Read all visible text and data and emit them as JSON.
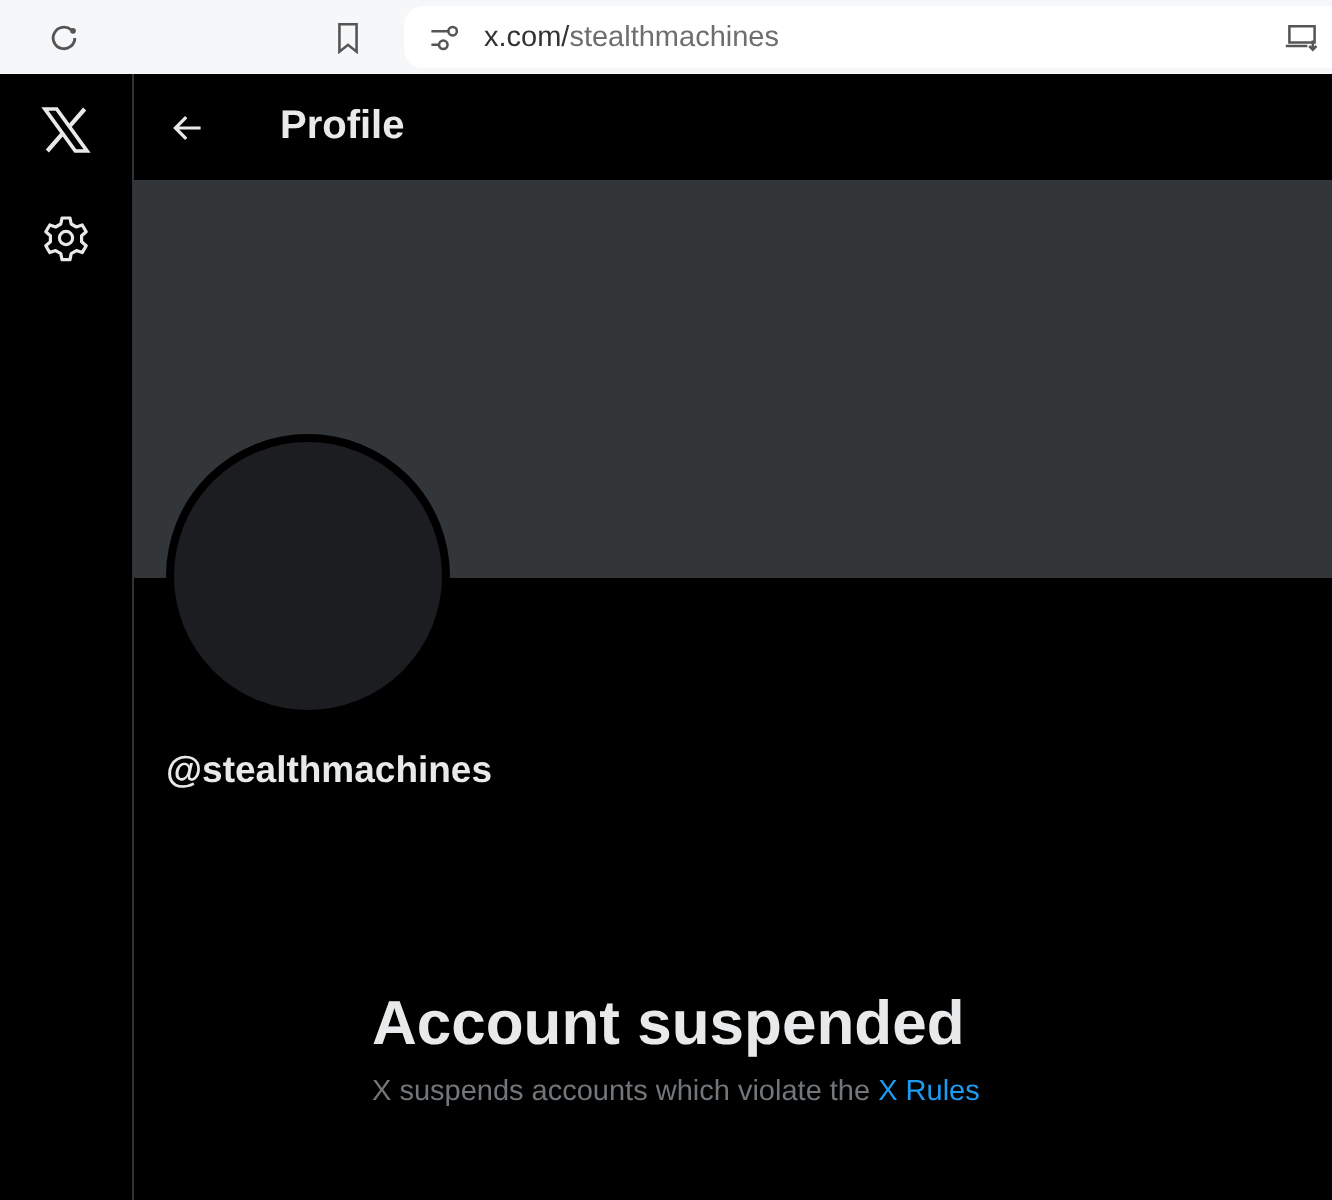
{
  "browser": {
    "url_host": "x.com/",
    "url_path": "stealthmachines"
  },
  "header": {
    "title": "Profile"
  },
  "profile": {
    "handle": "@stealthmachines"
  },
  "notice": {
    "title": "Account suspended",
    "message": "X suspends accounts which violate the ",
    "link": "X Rules"
  }
}
